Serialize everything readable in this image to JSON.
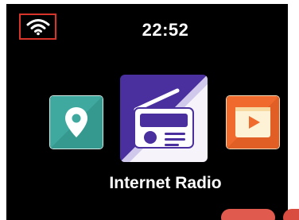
{
  "status_bar": {
    "wifi_icon": "wifi-icon",
    "wifi_highlight_color": "#d8342a",
    "time": "22:52"
  },
  "carousel": {
    "items": [
      {
        "id": "maps",
        "icon": "map-pin-icon",
        "color": "#3fa9a0"
      },
      {
        "id": "internet-radio",
        "icon": "radio-icon",
        "color": "#4a2f9e",
        "selected": true
      },
      {
        "id": "media",
        "icon": "play-icon",
        "color": "#ef6a2c"
      }
    ],
    "selected_label": "Internet Radio"
  },
  "colors": {
    "screen_background": "#000000",
    "text": "#ffffff",
    "bottom_buttons": "#e05a4e"
  }
}
